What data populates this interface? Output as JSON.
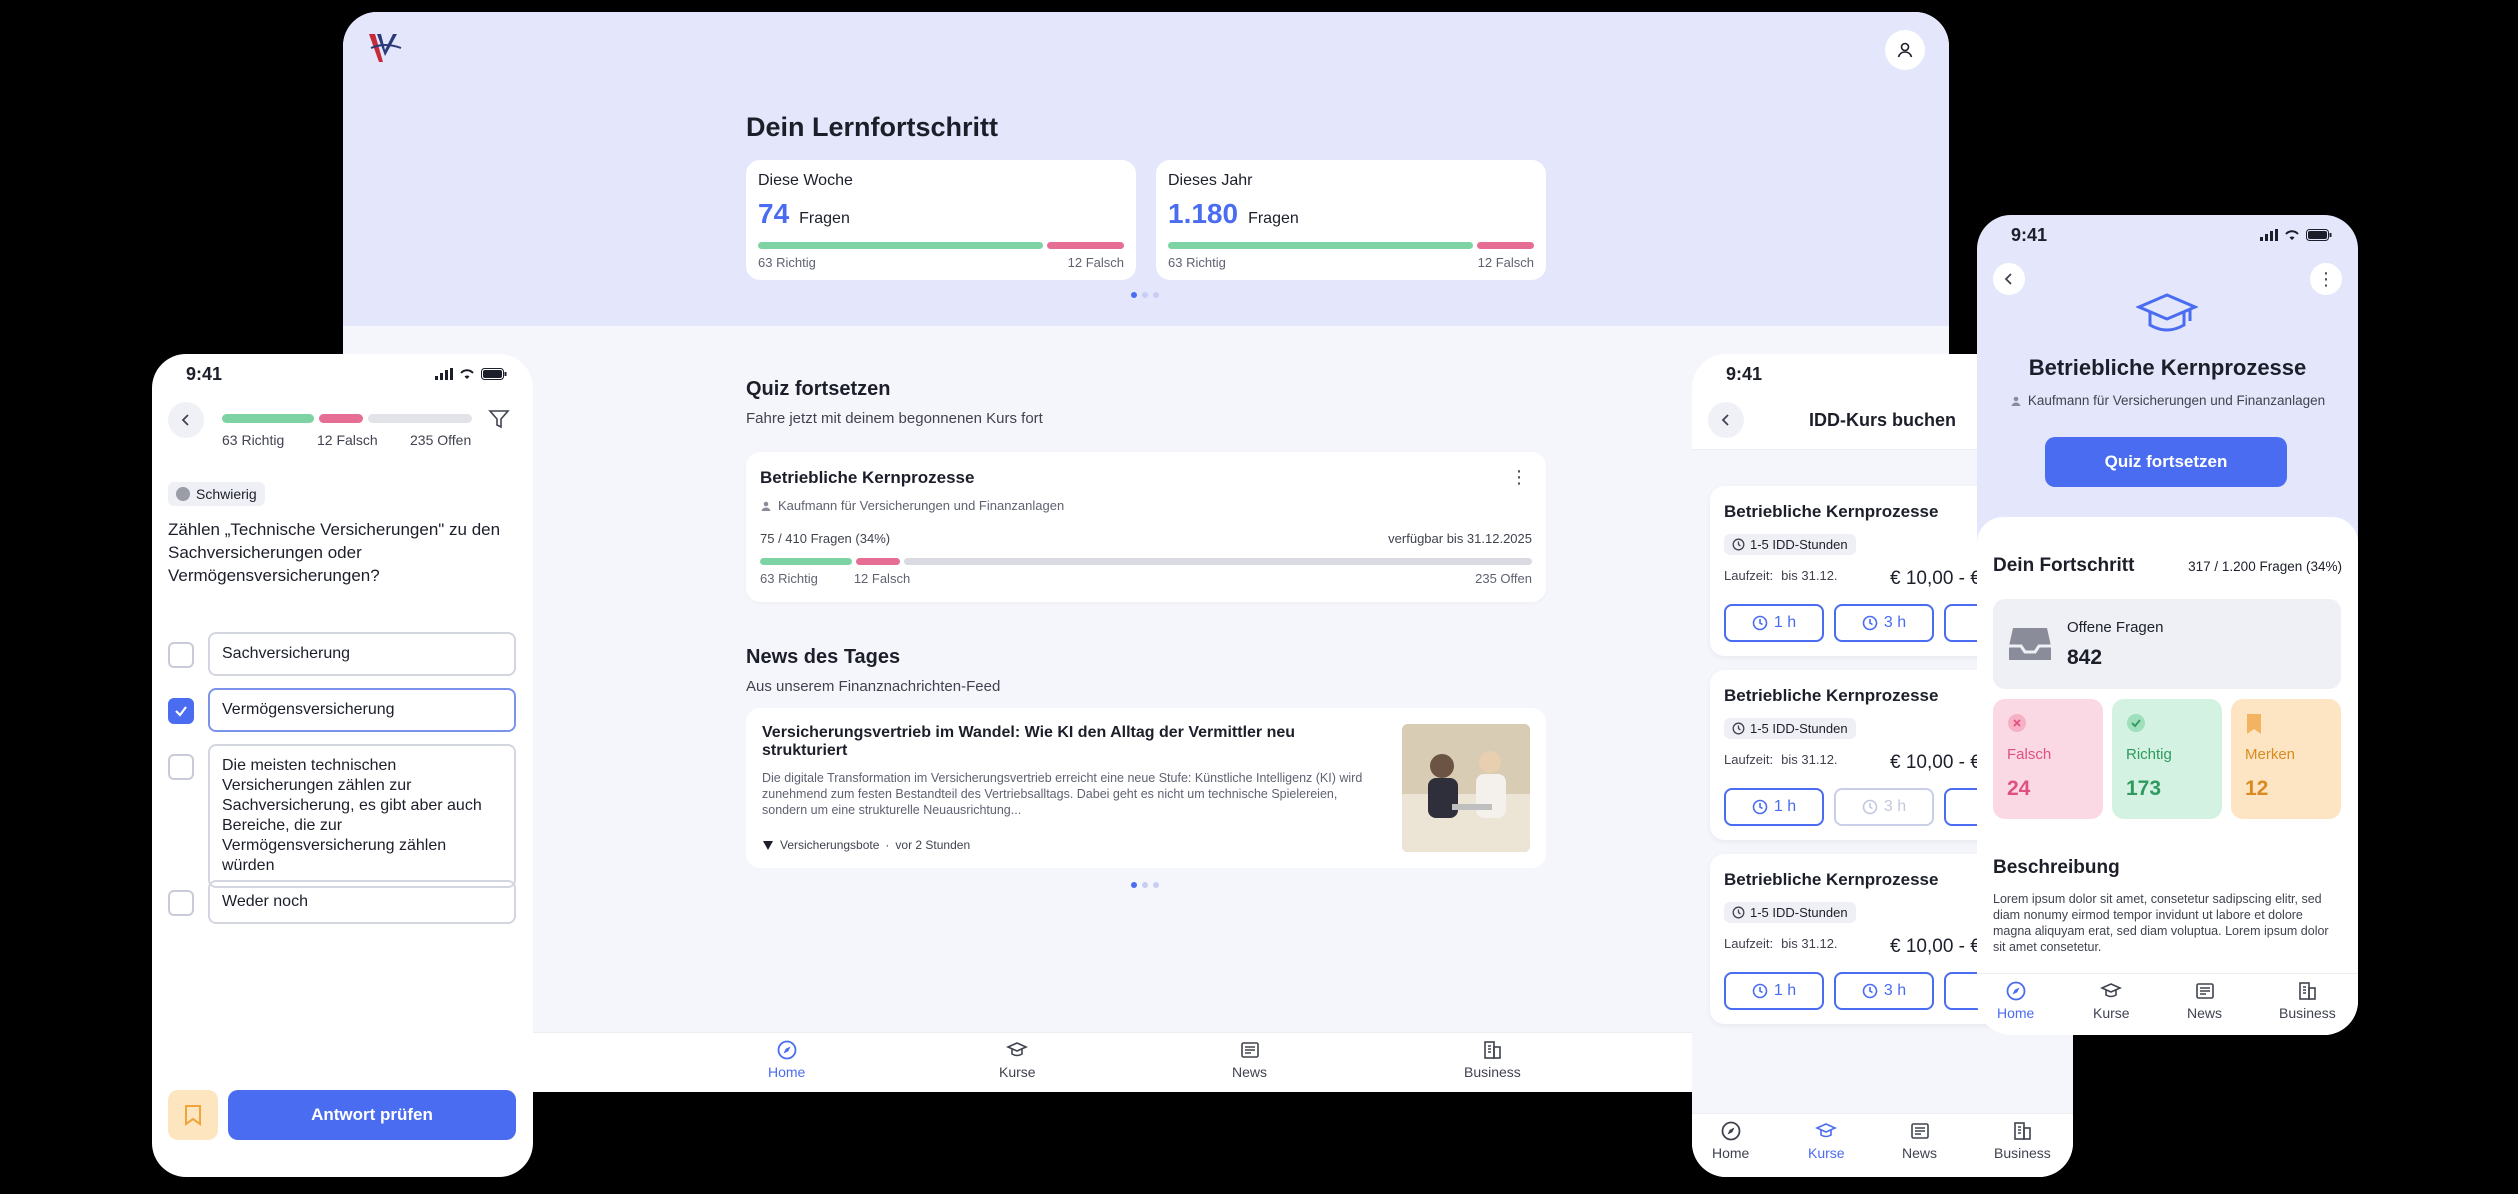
{
  "colors": {
    "accent": "#4a6cf0",
    "green": "#7dd3a3",
    "red": "#e66d94",
    "orange": "#f3b462"
  },
  "tablet": {
    "title": "Dein Lernfortschritt",
    "week": {
      "label": "Diese Woche",
      "value": "74",
      "unit": "Fragen",
      "right": "63 Richtig",
      "wrong": "12 Falsch"
    },
    "year": {
      "label": "Dieses Jahr",
      "value": "1.180",
      "unit": "Fragen",
      "right": "63 Richtig",
      "wrong": "12 Falsch"
    },
    "quiz": {
      "title": "Quiz fortsetzen",
      "subtitle": "Fahre jetzt mit deinem begonnenen Kurs fort",
      "card_title": "Betriebliche Kernprozesse",
      "card_subtitle": "Kaufmann für Versicherungen und Finanzanlagen",
      "progress": "75 / 410 Fragen (34%)",
      "available": "verfügbar bis 31.12.2025",
      "right": "63 Richtig",
      "wrong": "12 Falsch",
      "open": "235 Offen"
    },
    "news": {
      "title": "News des Tages",
      "subtitle": "Aus unserem Finanznachrichten-Feed",
      "headline": "Versicherungsvertrieb im Wandel: Wie KI den Alltag der Vermittler neu strukturiert",
      "text": "Die digitale Transformation im Versicherungsvertrieb erreicht eine neue Stufe: Künstliche Intelligenz (KI) wird zunehmend zum festen Bestandteil des Vertriebsalltags. Dabei geht es nicht um technische Spielereien, sondern um eine strukturelle Neuausrichtung...",
      "source": "Versicherungsbote",
      "sep": "·",
      "time": "vor 2 Stunden"
    },
    "nav": {
      "home": "Home",
      "kurse": "Kurse",
      "news": "News",
      "business": "Business"
    }
  },
  "phone_left": {
    "time": "9:41",
    "right": "63 Richtig",
    "wrong": "12 Falsch",
    "open": "235 Offen",
    "difficulty": "Schwierig",
    "question": "Zählen „Technische Versicherungen\" zu den Sachversicherungen oder Vermögensversicherungen?",
    "options": [
      "Sachversicherung",
      "Vermögensversicherung",
      "Die meisten technischen Versicherungen zählen zur Sachversicherung, es gibt aber auch Bereiche, die zur Vermögensversicherung zählen würden",
      "Weder noch"
    ],
    "submit": "Antwort prüfen"
  },
  "phone_middle": {
    "time": "9:41",
    "title": "IDD-Kurs buchen",
    "courses": [
      {
        "title": "Betriebliche Kernprozesse",
        "chip": "1-5 IDD-Stunden",
        "runtime_label": "Laufzeit:",
        "runtime": "bis 31.12.",
        "price": "€ 10,00 - €",
        "h1": "1 h",
        "h3": "3 h"
      },
      {
        "title": "Betriebliche Kernprozesse",
        "chip": "1-5 IDD-Stunden",
        "runtime_label": "Laufzeit:",
        "runtime": "bis 31.12.",
        "price": "€ 10,00 - €",
        "h1": "1 h",
        "h3": "3 h"
      },
      {
        "title": "Betriebliche Kernprozesse",
        "chip": "1-5 IDD-Stunden",
        "runtime_label": "Laufzeit:",
        "runtime": "bis 31.12.",
        "price": "€ 10,00 - €",
        "h1": "1 h",
        "h3": "3 h"
      }
    ],
    "nav": {
      "home": "Home",
      "kurse": "Kurse",
      "news": "News",
      "business": "Business"
    }
  },
  "phone_right": {
    "time": "9:41",
    "title": "Betriebliche Kernprozesse",
    "subtitle": "Kaufmann für Versicherungen und Finanzanlagen",
    "cta": "Quiz fortsetzen",
    "progress_title": "Dein Fortschritt",
    "progress_value": "317 / 1.200 Fragen (34%)",
    "open_label": "Offene Fragen",
    "open_value": "842",
    "wrong_label": "Falsch",
    "wrong_value": "24",
    "right_label": "Richtig",
    "right_value": "173",
    "mark_label": "Merken",
    "mark_value": "12",
    "desc_title": "Beschreibung",
    "desc_text": "Lorem ipsum dolor sit amet, consetetur sadipscing elitr, sed diam nonumy eirmod tempor invidunt ut labore et dolore magna aliquyam erat, sed diam voluptua. Lorem ipsum dolor sit amet consetetur.",
    "nav": {
      "home": "Home",
      "kurse": "Kurse",
      "news": "News",
      "business": "Business"
    }
  }
}
